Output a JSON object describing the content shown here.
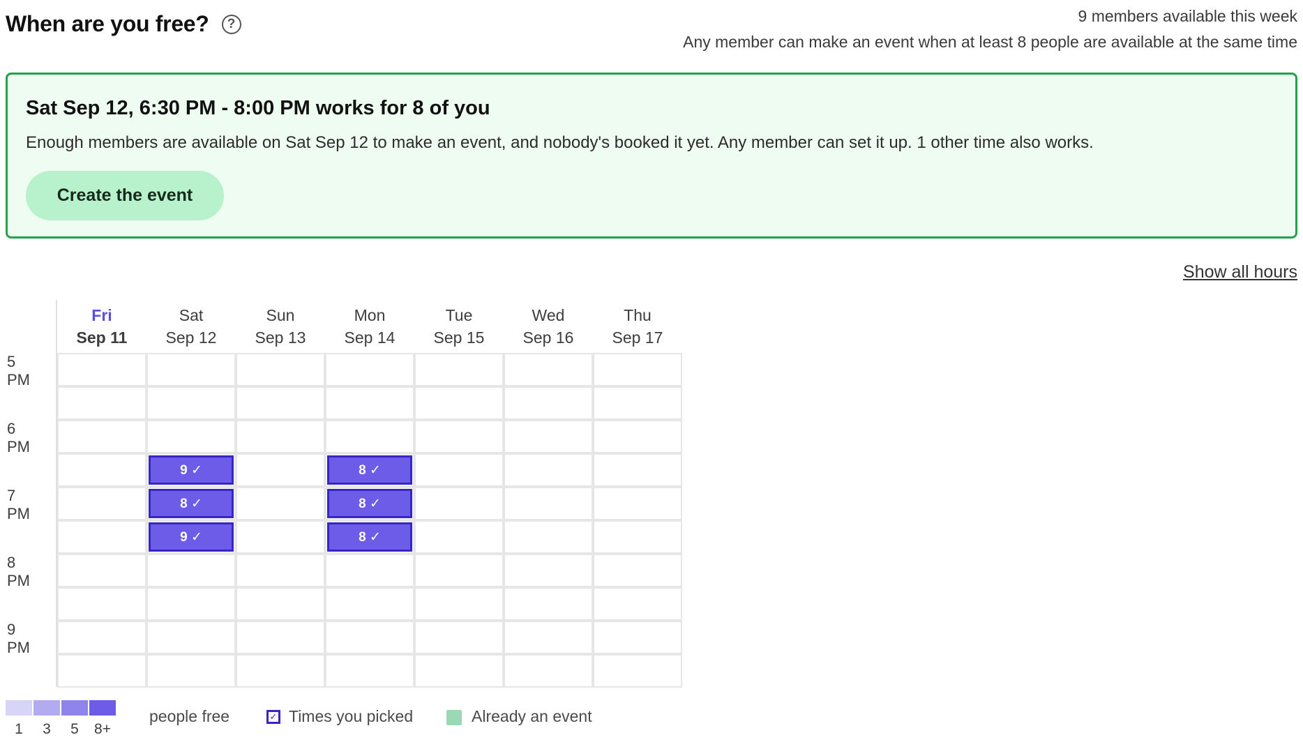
{
  "header": {
    "title": "When are you free?",
    "help_icon": "?",
    "members_available": "9 members available this week",
    "rule": "Any member can make an event when at least 8 people are available at the same time"
  },
  "banner": {
    "title": "Sat Sep 12, 6:30 PM - 8:00 PM works for 8 of you",
    "text": "Enough members are available on Sat Sep 12 to make an event, and nobody's booked it yet. Any member can set it up. 1 other time also works.",
    "button": "Create the event"
  },
  "show_all": "Show all hours",
  "days": [
    {
      "name": "Fri",
      "date": "Sep 11",
      "today": true
    },
    {
      "name": "Sat",
      "date": "Sep 12",
      "today": false
    },
    {
      "name": "Sun",
      "date": "Sep 13",
      "today": false
    },
    {
      "name": "Mon",
      "date": "Sep 14",
      "today": false
    },
    {
      "name": "Tue",
      "date": "Sep 15",
      "today": false
    },
    {
      "name": "Wed",
      "date": "Sep 16",
      "today": false
    },
    {
      "name": "Thu",
      "date": "Sep 17",
      "today": false
    }
  ],
  "time_labels": [
    "5 PM",
    "6 PM",
    "7 PM",
    "8 PM",
    "9 PM"
  ],
  "row_count": 10,
  "slots": [
    {
      "day": 1,
      "row": 3,
      "label": "9 ✓"
    },
    {
      "day": 1,
      "row": 4,
      "label": "8 ✓"
    },
    {
      "day": 1,
      "row": 5,
      "label": "9 ✓"
    },
    {
      "day": 3,
      "row": 3,
      "label": "8 ✓"
    },
    {
      "day": 3,
      "row": 4,
      "label": "8 ✓"
    },
    {
      "day": 3,
      "row": 5,
      "label": "8 ✓"
    }
  ],
  "legend": {
    "scale": [
      {
        "label": "1",
        "color": "#d8d4f7"
      },
      {
        "label": "3",
        "color": "#b3abf0"
      },
      {
        "label": "5",
        "color": "#8f83ec"
      },
      {
        "label": "8+",
        "color": "#6c5ce7"
      }
    ],
    "people_free": "people free",
    "picked": "Times you picked",
    "event": "Already an event"
  }
}
